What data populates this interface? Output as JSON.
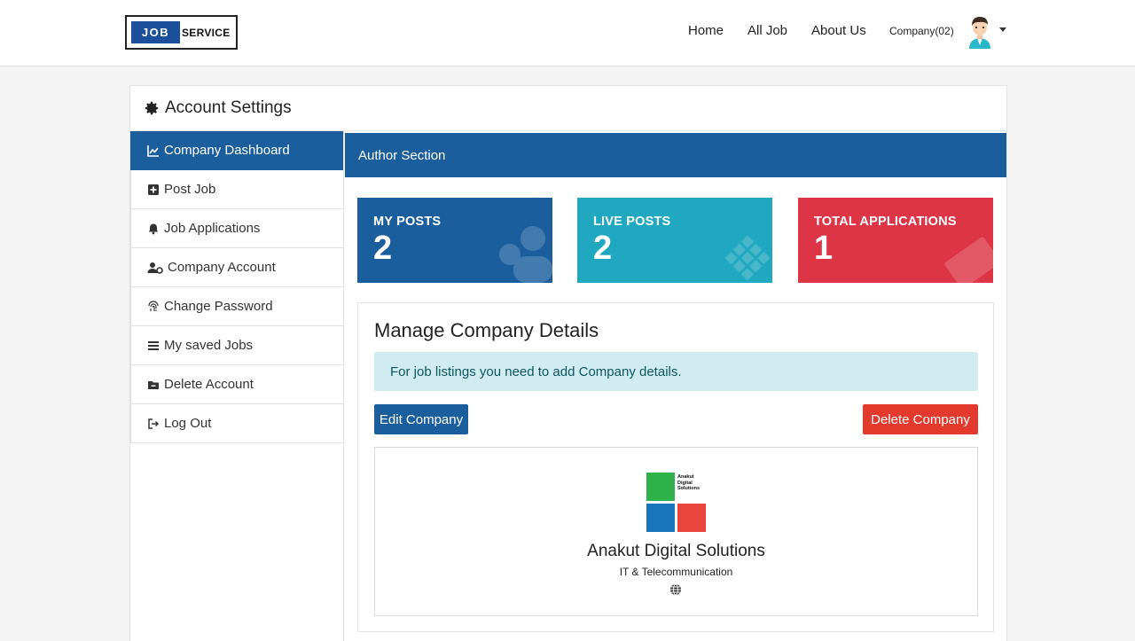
{
  "brand": {
    "logo_left": "JOB",
    "logo_right": "SERVICE"
  },
  "nav": {
    "home": "Home",
    "all_job": "All Job",
    "about": "About Us",
    "company": "Company(02)"
  },
  "settings": {
    "title": "Account Settings"
  },
  "sidebar": {
    "items": [
      {
        "label": "Company Dashboard",
        "icon": "chart-line-icon"
      },
      {
        "label": "Post Job",
        "icon": "plus-square-icon"
      },
      {
        "label": "Job Applications",
        "icon": "bell-icon"
      },
      {
        "label": "Company Account",
        "icon": "user-cog-icon"
      },
      {
        "label": "Change Password",
        "icon": "fingerprint-icon"
      },
      {
        "label": "My saved Jobs",
        "icon": "list-icon"
      },
      {
        "label": "Delete Account",
        "icon": "folder-icon"
      },
      {
        "label": "Log Out",
        "icon": "sign-out-icon"
      }
    ]
  },
  "author": {
    "title": "Author Section"
  },
  "stats": [
    {
      "label": "MY POSTS",
      "value": "2"
    },
    {
      "label": "LIVE POSTS",
      "value": "2"
    },
    {
      "label": "TOTAL APPLICATIONS",
      "value": "1"
    }
  ],
  "manage": {
    "title": "Manage Company Details",
    "alert": "For job listings you need to add Company details.",
    "edit_label": "Edit Company",
    "delete_label": "Delete Company"
  },
  "company": {
    "logo_text": [
      "Anakut",
      "Digital",
      "Solutions"
    ],
    "name": "Anakut Digital Solutions",
    "category": "IT & Telecommunication"
  },
  "colors": {
    "primary": "#1b5e9e",
    "teal": "#1fa8bf",
    "red": "#dd3446",
    "alert_bg": "#d1ecf1"
  }
}
